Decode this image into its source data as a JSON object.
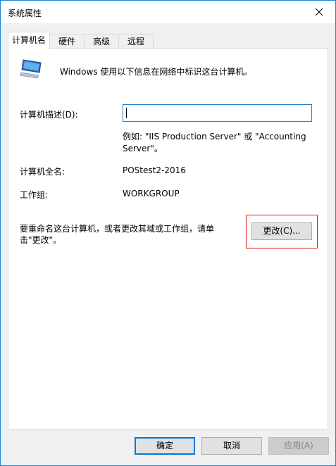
{
  "window": {
    "title": "系统属性",
    "close_icon": "close-icon"
  },
  "tabs": [
    {
      "label": "计算机名",
      "active": true
    },
    {
      "label": "硬件"
    },
    {
      "label": "高级"
    },
    {
      "label": "远程"
    }
  ],
  "panel": {
    "intro_text": "Windows 使用以下信息在网络中标识这台计算机。",
    "description_label": "计算机描述(D):",
    "description_value": "",
    "example_text": "例如: \"IIS Production Server\" 或 \"Accounting Server\"。",
    "full_name_label": "计算机全名:",
    "full_name_value": "POStest2-2016",
    "workgroup_label": "工作组:",
    "workgroup_value": "WORKGROUP",
    "rename_text": "要重命名这台计算机，或者更改其域或工作组，请单击\"更改\"。",
    "change_button": "更改(C)..."
  },
  "buttons": {
    "ok": "确定",
    "cancel": "取消",
    "apply": "应用(A)"
  },
  "colors": {
    "accent": "#0078d7",
    "highlight": "#e21b1b",
    "border": "#1883d7"
  }
}
